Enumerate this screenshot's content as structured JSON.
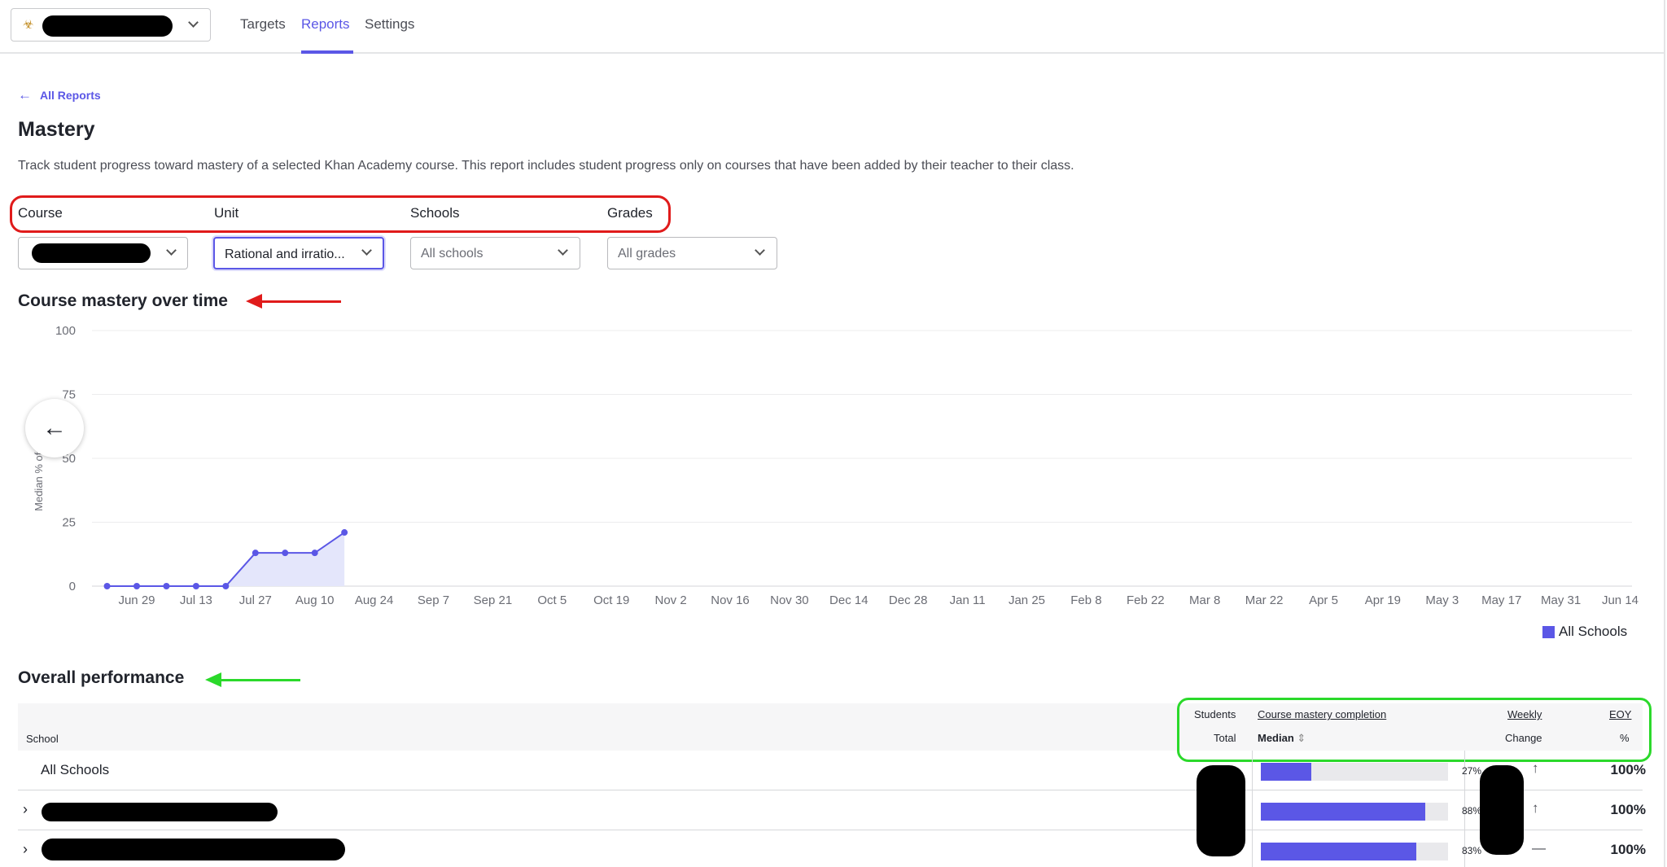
{
  "nav": {
    "tabs": [
      {
        "label": "Targets",
        "active": false
      },
      {
        "label": "Reports",
        "active": true
      },
      {
        "label": "Settings",
        "active": false
      }
    ],
    "org_icon": "org-badge-icon",
    "accent_color": "#5b57e6"
  },
  "header": {
    "back_label": "All Reports",
    "title": "Mastery",
    "description": "Track student progress toward mastery of a selected Khan Academy course. This report includes student progress only on courses that have been added by their teacher to their class."
  },
  "filters": {
    "course_label": "Course",
    "unit_label": "Unit",
    "unit_value": "Rational and irratio...",
    "schools_label": "Schools",
    "schools_value": "All schools",
    "grades_label": "Grades",
    "grades_value": "All grades"
  },
  "chart_section": {
    "title": "Course mastery over time"
  },
  "chart_data": {
    "type": "area",
    "title": "Course mastery over time",
    "ylabel": "Median % of course mastery",
    "ylabel_visible": "Median % of co... tery",
    "ylim": [
      0,
      100
    ],
    "yticks": [
      0,
      25,
      50,
      75,
      100
    ],
    "x_tick_labels": [
      "Jun 29",
      "Jul 13",
      "Jul 27",
      "Aug 10",
      "Aug 24",
      "Sep 7",
      "Sep 21",
      "Oct 5",
      "Oct 19",
      "Nov 2",
      "Nov 16",
      "Nov 30",
      "Dec 14",
      "Dec 28",
      "Jan 11",
      "Jan 25",
      "Feb 8",
      "Feb 22",
      "Mar 8",
      "Mar 22",
      "Apr 5",
      "Apr 19",
      "May 3",
      "May 17",
      "May 31",
      "Jun 14"
    ],
    "grid": true,
    "legend_position": "bottom-right",
    "series": [
      {
        "name": "All Schools",
        "color": "#5b57e6",
        "points": [
          {
            "x": "Jun 22",
            "y": 0
          },
          {
            "x": "Jun 29",
            "y": 0
          },
          {
            "x": "Jul 6",
            "y": 0
          },
          {
            "x": "Jul 13",
            "y": 0
          },
          {
            "x": "Jul 20",
            "y": 0
          },
          {
            "x": "Jul 27",
            "y": 13
          },
          {
            "x": "Aug 3",
            "y": 13
          },
          {
            "x": "Aug 10",
            "y": 13
          },
          {
            "x": "Aug 17",
            "y": 21
          }
        ]
      }
    ]
  },
  "performance": {
    "title": "Overall performance",
    "headers": {
      "school": "School",
      "students": "Students",
      "total": "Total",
      "mastery_completion": "Course mastery completion",
      "median": "Median",
      "weekly": "Weekly",
      "change": "Change",
      "eoy": "EOY",
      "pct": "%"
    },
    "rows": [
      {
        "name": "All Schools",
        "expandable": false,
        "median_pct_value": 27,
        "median_pct": "27%",
        "change": "↑",
        "eoy": "100%"
      },
      {
        "name": "",
        "expandable": true,
        "median_pct_value": 88,
        "median_pct": "88%",
        "change": "↑",
        "eoy": "100%"
      },
      {
        "name": "",
        "expandable": true,
        "median_pct_value": 83,
        "median_pct": "83%",
        "change": "—",
        "eoy": "100%"
      }
    ]
  },
  "annotations": {
    "red_color": "#e01b1b",
    "green_color": "#2bd92b"
  }
}
